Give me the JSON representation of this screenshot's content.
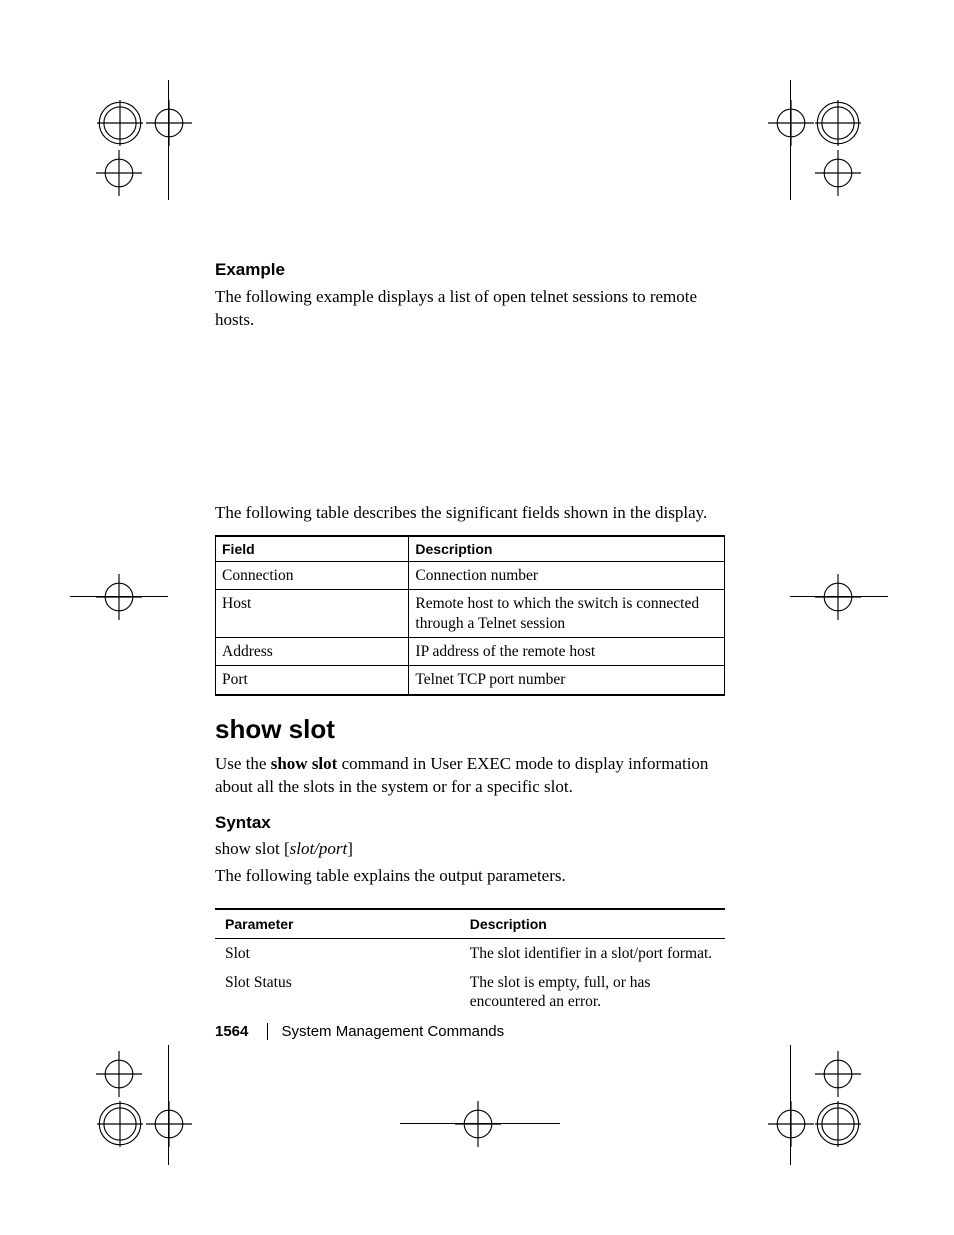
{
  "example": {
    "heading": "Example",
    "intro": "The following example displays a list of open telnet sessions to remote hosts."
  },
  "fieldTable": {
    "intro": "The following table describes the significant fields shown in the display.",
    "headers": {
      "field": "Field",
      "desc": "Description"
    },
    "rows": [
      {
        "field": "Connection",
        "desc": "Connection number"
      },
      {
        "field": "Host",
        "desc": "Remote host to which the switch is connected through a Telnet session"
      },
      {
        "field": "Address",
        "desc": "IP address of the remote host"
      },
      {
        "field": "Port",
        "desc": "Telnet TCP port number"
      }
    ]
  },
  "command": {
    "title": "show slot",
    "desc_prefix": "Use the ",
    "desc_bold": "show slot",
    "desc_suffix": " command in User EXEC mode to display information about all the slots in the system or for a specific slot."
  },
  "syntax": {
    "heading": "Syntax",
    "cmd_prefix": "show slot [",
    "cmd_italic": "slot/port",
    "cmd_suffix": "]",
    "intro": "The following table explains the output parameters."
  },
  "paramTable": {
    "headers": {
      "param": "Parameter",
      "desc": "Description"
    },
    "rows": [
      {
        "param": "Slot",
        "desc": "The slot identifier in a slot/port format."
      },
      {
        "param": "Slot Status",
        "desc": "The slot is empty, full, or has encountered an error."
      }
    ]
  },
  "footer": {
    "page": "1564",
    "section": "System Management Commands"
  }
}
